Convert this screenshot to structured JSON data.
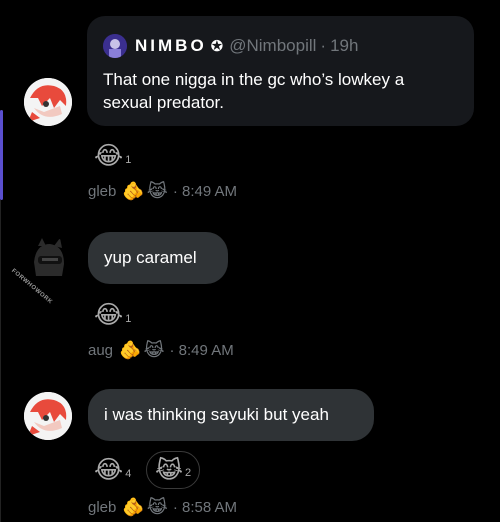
{
  "quote": {
    "author_name": "NIMBO",
    "badge": "✪",
    "handle": "@Nimbopill",
    "separator": "·",
    "age": "19h",
    "text": "That one nigga in the gc who’s lowkey a sexual predator."
  },
  "messages": [
    {
      "reaction": {
        "emoji": "😂",
        "count": "1"
      },
      "meta": {
        "sender": "gleb",
        "icons": [
          "🫵",
          "😹"
        ],
        "time": "· 8:49 AM"
      }
    },
    {
      "text": "yup caramel",
      "reaction": {
        "emoji": "😂",
        "count": "1"
      },
      "meta": {
        "sender": "aug",
        "icons": [
          "🫵",
          "😹"
        ],
        "time": "· 8:49 AM"
      },
      "avatar_caption": "FORWHOWORK"
    },
    {
      "text": "i was thinking sayuki but yeah",
      "reactions": [
        {
          "emoji": "😂",
          "count": "4"
        },
        {
          "emoji": "😹",
          "count": "2"
        }
      ],
      "meta": {
        "sender": "gleb",
        "icons": [
          "🫵",
          "😹"
        ],
        "time": "· 8:58 AM"
      }
    }
  ],
  "colors": {
    "background": "#000000",
    "bubble": "#2f3336",
    "card": "#16181c",
    "muted": "#71767b",
    "accent": "#5a4fcf"
  }
}
